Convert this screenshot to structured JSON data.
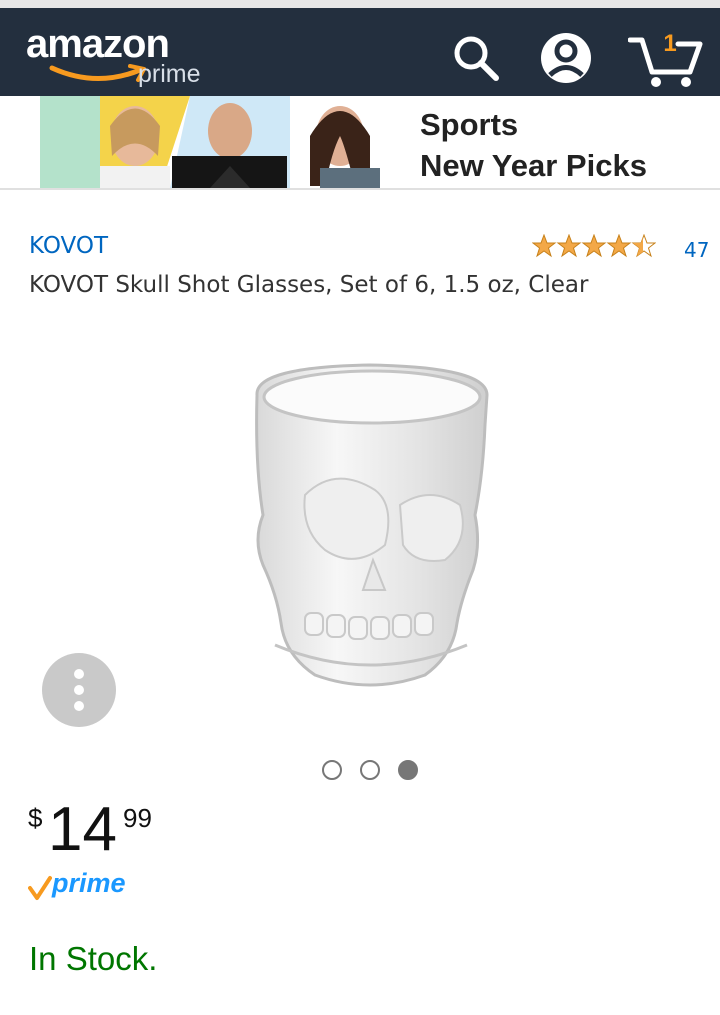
{
  "header": {
    "logo_text": "amazon",
    "logo_sub": "prime",
    "cart_count": "1"
  },
  "banner": {
    "line1": "Sports",
    "line2": "New Year Picks"
  },
  "product": {
    "brand": "KOVOT",
    "title": "KOVOT Skull Shot Glasses, Set of 6, 1.5 oz, Clear",
    "rating": 4.5,
    "review_count": "47",
    "price_symbol": "$",
    "price_whole": "14",
    "price_fraction": "99",
    "prime_label": "prime",
    "availability": "In Stock.",
    "image_count": 3,
    "current_image": 3
  },
  "colors": {
    "header_bg": "#232f3e",
    "link_blue": "#0066c0",
    "prime_blue": "#1a98ff",
    "prime_check": "#f79a1f",
    "in_stock_green": "#007600",
    "star_orange": "#f3a847"
  },
  "icons": [
    "search-icon",
    "account-icon",
    "cart-icon",
    "more-options-icon",
    "prime-check-icon"
  ]
}
